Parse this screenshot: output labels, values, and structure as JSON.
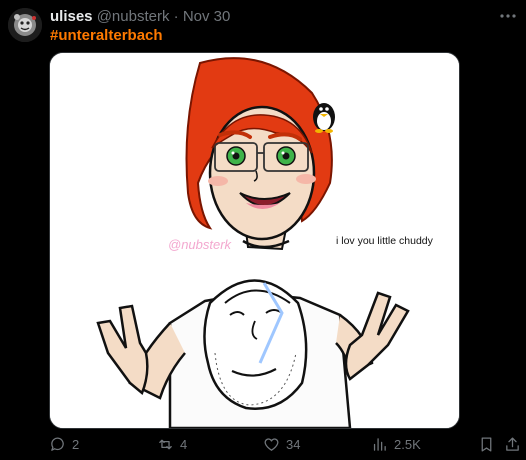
{
  "post": {
    "author_name": "ulises",
    "author_handle": "@nubsterk",
    "separator": "·",
    "date": "Nov 30",
    "hashtag": "#unteralterbach",
    "more_icon": "more-dots-icon"
  },
  "media": {
    "watermark": "@nubsterk",
    "caption": "i lov you little chuddy"
  },
  "actions": {
    "replies": "2",
    "reposts": "4",
    "likes": "34",
    "views": "2.5K"
  },
  "colors": {
    "background": "#000000",
    "hashtag": "#ff7a00",
    "muted": "#71767b",
    "hair": "#e23a12"
  }
}
